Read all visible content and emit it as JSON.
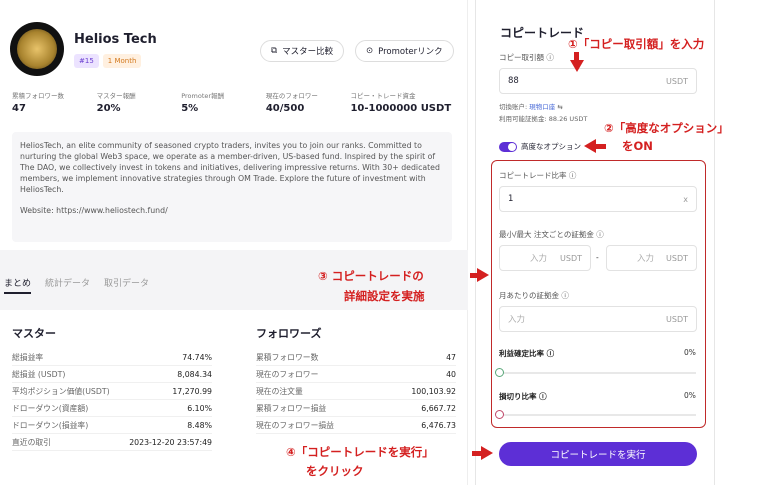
{
  "profile": {
    "name": "Helios Tech",
    "badge_rank": "#15",
    "badge_period": "1 Month",
    "compare_button": "マスター比較",
    "promoter_button": "Promoterリンク"
  },
  "stats": [
    {
      "label": "累積フォロワー数",
      "value": "47"
    },
    {
      "label": "マスター報酬",
      "value": "20%"
    },
    {
      "label": "Promoter報酬",
      "value": "5%"
    },
    {
      "label": "現在のフォロワー",
      "value": "40/500"
    },
    {
      "label": "コピー・トレード資金",
      "value": "10-1000000 USDT"
    }
  ],
  "description": {
    "text": "HeliosTech, an elite community of seasoned crypto traders, invites you to join our ranks. Committed to nurturing the global Web3 space, we operate as a member-driven, US-based fund. Inspired by the spirit of The DAO, we collectively invest in tokens and initiatives, delivering impressive returns. With 30+ dedicated members, we implement innovative strategies through OM Trade. Explore the future of investment with HeliosTech.",
    "website": "Website: https://www.heliostech.fund/"
  },
  "tabs": [
    "まとめ",
    "統計データ",
    "取引データ"
  ],
  "master_table": {
    "title": "マスター",
    "rows": [
      {
        "k": "総損益率",
        "v": "74.74%"
      },
      {
        "k": "総損益 (USDT)",
        "v": "8,084.34"
      },
      {
        "k": "平均ポジション価値(USDT)",
        "v": "17,270.99"
      },
      {
        "k": "ドローダウン(資産額)",
        "v": "6.10%"
      },
      {
        "k": "ドローダウン(損益率)",
        "v": "8.48%"
      },
      {
        "k": "直近の取引",
        "v": "2023-12-20 23:57:49"
      }
    ]
  },
  "follower_table": {
    "title": "フォロワーズ",
    "rows": [
      {
        "k": "累積フォロワー数",
        "v": "47"
      },
      {
        "k": "現在のフォロワー",
        "v": "40"
      },
      {
        "k": "現在の注文量",
        "v": "100,103.92"
      },
      {
        "k": "累積フォロワー損益",
        "v": "6,667.72"
      },
      {
        "k": "現在のフォロワー損益",
        "v": "6,476.73"
      }
    ]
  },
  "copy_panel": {
    "title": "コピートレード",
    "amount_label": "コピー取引額",
    "amount_value": "88",
    "unit": "USDT",
    "account_prefix": "切換账户:",
    "account_name": "現物口座",
    "available": "利用可能証拠金: 88.26 USDT",
    "advanced_label": "高度なオプション",
    "ratio_label": "コピートレード比率",
    "ratio_value": "1",
    "ratio_unit": "x",
    "minmax_label": "最小/最大 注文ごとの証拠金",
    "input_placeholder": "入力",
    "dash": "-",
    "monthly_label": "月あたりの証拠金",
    "tp_label": "利益確定比率",
    "tp_value": "0%",
    "sl_label": "損切り比率",
    "sl_value": "0%",
    "execute_button": "コピートレードを実行"
  },
  "annotations": {
    "a1": "①「コピー取引額」を入力",
    "a2_line1": "②「高度なオプション」",
    "a2_line2": "をON",
    "a3_line1": "③ コピートレードの",
    "a3_line2": "詳細設定を実施",
    "a4_line1": "④「コピートレードを実行」",
    "a4_line2": "をクリック"
  }
}
